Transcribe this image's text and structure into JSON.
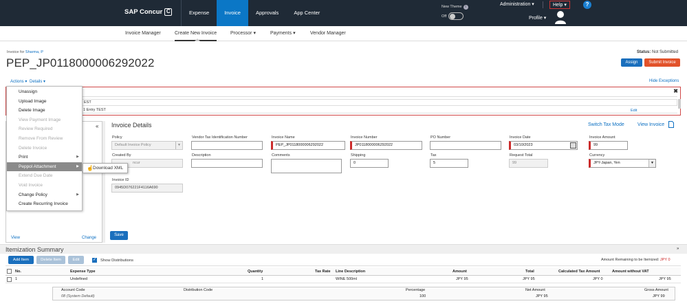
{
  "header": {
    "logo": "SAP Concur",
    "logo_c": "C",
    "nav": [
      "Expense",
      "Invoice",
      "Approvals",
      "App Center"
    ],
    "new_theme": "New Theme",
    "toggle_state": "Off",
    "administration": "Administration",
    "help": "Help",
    "help_icon": "?",
    "profile": "Profile"
  },
  "subnav": [
    "Invoice Manager",
    "Create New Invoice",
    "Processor",
    "Payments",
    "Vendor Manager"
  ],
  "page": {
    "invoice_for_label": "Invoice for",
    "invoice_for_name": "Sharma, P",
    "title": "PEP_JP0118000006292022",
    "status_label": "Status:",
    "status_value": "Not Submitted",
    "assign": "Assign",
    "submit": "Submit Invoice",
    "actions": "Actions",
    "details": "Details",
    "hide_exceptions": "Hide Exceptions"
  },
  "exceptions": {
    "row1": "EST",
    "row2": "1 Entry TEST",
    "edit": "Edit",
    "close": "✖"
  },
  "menu": {
    "items": [
      {
        "label": "Unassign",
        "disabled": false
      },
      {
        "label": "Upload Image",
        "disabled": false
      },
      {
        "label": "Delete Image",
        "disabled": false
      },
      {
        "label": "View Payment Image",
        "disabled": true
      },
      {
        "label": "Review Required",
        "disabled": true
      },
      {
        "label": "Remove From Review",
        "disabled": true
      },
      {
        "label": "Delete Invoice",
        "disabled": true
      },
      {
        "label": "Print",
        "disabled": false,
        "arrow": "▶"
      },
      {
        "label": "Peppol Attachment",
        "disabled": false,
        "arrow": "▶",
        "highlight": true
      },
      {
        "label": "Extend Due Date",
        "disabled": true
      },
      {
        "label": "Void Invoice",
        "disabled": true
      },
      {
        "label": "Change Policy",
        "disabled": false,
        "arrow": "▶"
      },
      {
        "label": "Create Recurring Invoice",
        "disabled": false
      }
    ],
    "submenu": "Download XML"
  },
  "leftpanel": {
    "collapse": "«",
    "view": "View",
    "change": "Change"
  },
  "invoice_details": {
    "heading": "Invoice Details",
    "switch_tax": "Switch Tax Mode",
    "view_invoice": "View Invoice",
    "policy_label": "Policy",
    "policy_value": "Default Invoice Policy",
    "vtin_label": "Vendor Tax Identification Number",
    "vtin_value": "",
    "name_label": "Invoice Name",
    "name_value": "PEP_JP0118000006292022",
    "number_label": "Invoice Number",
    "number_value": "JP0118000006292022",
    "po_label": "PO Number",
    "po_value": "",
    "date_label": "Invoice Date",
    "date_value": "03/10/2023",
    "amount_label": "Invoice Amount",
    "amount_value": "99",
    "created_label": "Created By",
    "created_value": "ncur",
    "desc_label": "Description",
    "desc_value": "",
    "comments_label": "Comments",
    "comments_value": "",
    "shipping_label": "Shipping",
    "shipping_value": "0",
    "tax_label": "Tax",
    "tax_value": "5",
    "reqtotal_label": "Request Total",
    "reqtotal_value": "99",
    "currency_label": "Currency",
    "currency_value": "JPY-Japan, Yen",
    "invid_label": "Invoice ID",
    "invid_value": "0945D076221F4116A690",
    "save": "Save"
  },
  "itemization": {
    "title": "Itemization Summary",
    "collapse": "»",
    "add": "Add Item",
    "delete": "Delete Item",
    "edit": "Edit",
    "show_dist": "Show Distributions",
    "remaining_label": "Amount Remaining to be Itemized:",
    "remaining_value": "JPY 0",
    "columns": [
      "No.",
      "Expense Type",
      "Quantity",
      "Tax Rate",
      "Line Description",
      "Amount",
      "Total",
      "Calculated Tax Amount",
      "Amount without VAT"
    ],
    "row": [
      "1",
      "Undefined",
      "1",
      "",
      "WINE 500ml",
      "JPY 95",
      "JPY 95",
      "JPY 0",
      "JPY 95"
    ],
    "dist_columns": [
      "Account Code",
      "Distribution Code",
      "Percentage",
      "Net Amount",
      "Gross Amount"
    ],
    "dist_row": [
      "08 (System Default)",
      "",
      "100",
      "JPY 95",
      "JPY 99"
    ]
  }
}
